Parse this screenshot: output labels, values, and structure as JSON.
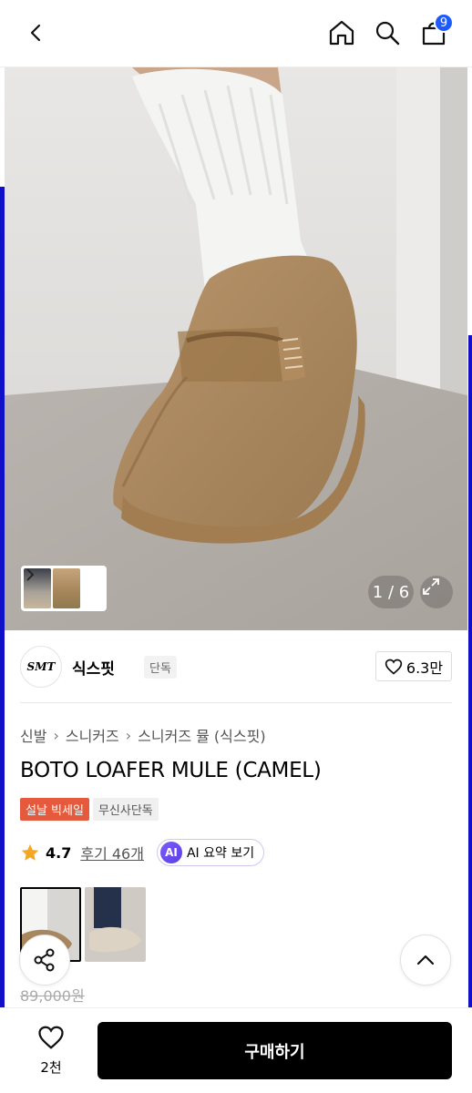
{
  "header": {
    "cart_count": "9",
    "icons": [
      "back-icon",
      "home-icon",
      "search-icon",
      "cart-icon"
    ]
  },
  "gallery": {
    "counter": "1 / 6"
  },
  "brand": {
    "logo_text": "SMT",
    "name": "식스핏",
    "tag": "단독",
    "likes": "6.3만"
  },
  "breadcrumb": [
    "신발",
    "스니커즈",
    "스니커즈 뮬 (식스핏)"
  ],
  "product": {
    "title": "BOTO LOAFER MULE (CAMEL)",
    "tag_sale": "설날 빅세일",
    "tag_exclusive": "무신사단독",
    "rating": "4.7",
    "reviews": "후기 46개",
    "ai_badge": "AI",
    "ai_label": "AI 요약 보기",
    "original_price": "89,000원"
  },
  "bottom": {
    "wish_count": "2천",
    "buy_label": "구매하기"
  },
  "colors": {
    "accent": "#1e5bff",
    "sale": "#e55a3c",
    "shoe": "#a8875f",
    "side_bars": "#1010c8"
  }
}
